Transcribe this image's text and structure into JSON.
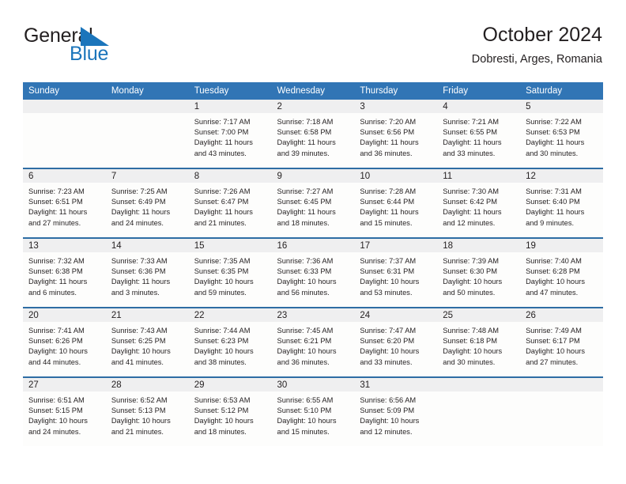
{
  "brand": {
    "name_part1": "General",
    "name_part2": "Blue",
    "flag_color": "#1b75bb",
    "text_color": "#231f20"
  },
  "header": {
    "title": "October 2024",
    "subtitle": "Dobresti, Arges, Romania"
  },
  "theme": {
    "header_blue": "#3175b5",
    "row_rule_blue": "#2e6da4",
    "daynum_band": "#efeff0",
    "cell_background": "#fdfdfc"
  },
  "weekday_headers": [
    "Sunday",
    "Monday",
    "Tuesday",
    "Wednesday",
    "Thursday",
    "Friday",
    "Saturday"
  ],
  "weeks": [
    [
      {
        "day": "",
        "sunrise": "",
        "sunset": "",
        "daylight_line1": "",
        "daylight_line2": "",
        "empty": true
      },
      {
        "day": "",
        "sunrise": "",
        "sunset": "",
        "daylight_line1": "",
        "daylight_line2": "",
        "empty": true
      },
      {
        "day": "1",
        "sunrise": "Sunrise: 7:17 AM",
        "sunset": "Sunset: 7:00 PM",
        "daylight_line1": "Daylight: 11 hours",
        "daylight_line2": "and 43 minutes."
      },
      {
        "day": "2",
        "sunrise": "Sunrise: 7:18 AM",
        "sunset": "Sunset: 6:58 PM",
        "daylight_line1": "Daylight: 11 hours",
        "daylight_line2": "and 39 minutes."
      },
      {
        "day": "3",
        "sunrise": "Sunrise: 7:20 AM",
        "sunset": "Sunset: 6:56 PM",
        "daylight_line1": "Daylight: 11 hours",
        "daylight_line2": "and 36 minutes."
      },
      {
        "day": "4",
        "sunrise": "Sunrise: 7:21 AM",
        "sunset": "Sunset: 6:55 PM",
        "daylight_line1": "Daylight: 11 hours",
        "daylight_line2": "and 33 minutes."
      },
      {
        "day": "5",
        "sunrise": "Sunrise: 7:22 AM",
        "sunset": "Sunset: 6:53 PM",
        "daylight_line1": "Daylight: 11 hours",
        "daylight_line2": "and 30 minutes."
      }
    ],
    [
      {
        "day": "6",
        "sunrise": "Sunrise: 7:23 AM",
        "sunset": "Sunset: 6:51 PM",
        "daylight_line1": "Daylight: 11 hours",
        "daylight_line2": "and 27 minutes."
      },
      {
        "day": "7",
        "sunrise": "Sunrise: 7:25 AM",
        "sunset": "Sunset: 6:49 PM",
        "daylight_line1": "Daylight: 11 hours",
        "daylight_line2": "and 24 minutes."
      },
      {
        "day": "8",
        "sunrise": "Sunrise: 7:26 AM",
        "sunset": "Sunset: 6:47 PM",
        "daylight_line1": "Daylight: 11 hours",
        "daylight_line2": "and 21 minutes."
      },
      {
        "day": "9",
        "sunrise": "Sunrise: 7:27 AM",
        "sunset": "Sunset: 6:45 PM",
        "daylight_line1": "Daylight: 11 hours",
        "daylight_line2": "and 18 minutes."
      },
      {
        "day": "10",
        "sunrise": "Sunrise: 7:28 AM",
        "sunset": "Sunset: 6:44 PM",
        "daylight_line1": "Daylight: 11 hours",
        "daylight_line2": "and 15 minutes."
      },
      {
        "day": "11",
        "sunrise": "Sunrise: 7:30 AM",
        "sunset": "Sunset: 6:42 PM",
        "daylight_line1": "Daylight: 11 hours",
        "daylight_line2": "and 12 minutes."
      },
      {
        "day": "12",
        "sunrise": "Sunrise: 7:31 AM",
        "sunset": "Sunset: 6:40 PM",
        "daylight_line1": "Daylight: 11 hours",
        "daylight_line2": "and 9 minutes."
      }
    ],
    [
      {
        "day": "13",
        "sunrise": "Sunrise: 7:32 AM",
        "sunset": "Sunset: 6:38 PM",
        "daylight_line1": "Daylight: 11 hours",
        "daylight_line2": "and 6 minutes."
      },
      {
        "day": "14",
        "sunrise": "Sunrise: 7:33 AM",
        "sunset": "Sunset: 6:36 PM",
        "daylight_line1": "Daylight: 11 hours",
        "daylight_line2": "and 3 minutes."
      },
      {
        "day": "15",
        "sunrise": "Sunrise: 7:35 AM",
        "sunset": "Sunset: 6:35 PM",
        "daylight_line1": "Daylight: 10 hours",
        "daylight_line2": "and 59 minutes."
      },
      {
        "day": "16",
        "sunrise": "Sunrise: 7:36 AM",
        "sunset": "Sunset: 6:33 PM",
        "daylight_line1": "Daylight: 10 hours",
        "daylight_line2": "and 56 minutes."
      },
      {
        "day": "17",
        "sunrise": "Sunrise: 7:37 AM",
        "sunset": "Sunset: 6:31 PM",
        "daylight_line1": "Daylight: 10 hours",
        "daylight_line2": "and 53 minutes."
      },
      {
        "day": "18",
        "sunrise": "Sunrise: 7:39 AM",
        "sunset": "Sunset: 6:30 PM",
        "daylight_line1": "Daylight: 10 hours",
        "daylight_line2": "and 50 minutes."
      },
      {
        "day": "19",
        "sunrise": "Sunrise: 7:40 AM",
        "sunset": "Sunset: 6:28 PM",
        "daylight_line1": "Daylight: 10 hours",
        "daylight_line2": "and 47 minutes."
      }
    ],
    [
      {
        "day": "20",
        "sunrise": "Sunrise: 7:41 AM",
        "sunset": "Sunset: 6:26 PM",
        "daylight_line1": "Daylight: 10 hours",
        "daylight_line2": "and 44 minutes."
      },
      {
        "day": "21",
        "sunrise": "Sunrise: 7:43 AM",
        "sunset": "Sunset: 6:25 PM",
        "daylight_line1": "Daylight: 10 hours",
        "daylight_line2": "and 41 minutes."
      },
      {
        "day": "22",
        "sunrise": "Sunrise: 7:44 AM",
        "sunset": "Sunset: 6:23 PM",
        "daylight_line1": "Daylight: 10 hours",
        "daylight_line2": "and 38 minutes."
      },
      {
        "day": "23",
        "sunrise": "Sunrise: 7:45 AM",
        "sunset": "Sunset: 6:21 PM",
        "daylight_line1": "Daylight: 10 hours",
        "daylight_line2": "and 36 minutes."
      },
      {
        "day": "24",
        "sunrise": "Sunrise: 7:47 AM",
        "sunset": "Sunset: 6:20 PM",
        "daylight_line1": "Daylight: 10 hours",
        "daylight_line2": "and 33 minutes."
      },
      {
        "day": "25",
        "sunrise": "Sunrise: 7:48 AM",
        "sunset": "Sunset: 6:18 PM",
        "daylight_line1": "Daylight: 10 hours",
        "daylight_line2": "and 30 minutes."
      },
      {
        "day": "26",
        "sunrise": "Sunrise: 7:49 AM",
        "sunset": "Sunset: 6:17 PM",
        "daylight_line1": "Daylight: 10 hours",
        "daylight_line2": "and 27 minutes."
      }
    ],
    [
      {
        "day": "27",
        "sunrise": "Sunrise: 6:51 AM",
        "sunset": "Sunset: 5:15 PM",
        "daylight_line1": "Daylight: 10 hours",
        "daylight_line2": "and 24 minutes."
      },
      {
        "day": "28",
        "sunrise": "Sunrise: 6:52 AM",
        "sunset": "Sunset: 5:13 PM",
        "daylight_line1": "Daylight: 10 hours",
        "daylight_line2": "and 21 minutes."
      },
      {
        "day": "29",
        "sunrise": "Sunrise: 6:53 AM",
        "sunset": "Sunset: 5:12 PM",
        "daylight_line1": "Daylight: 10 hours",
        "daylight_line2": "and 18 minutes."
      },
      {
        "day": "30",
        "sunrise": "Sunrise: 6:55 AM",
        "sunset": "Sunset: 5:10 PM",
        "daylight_line1": "Daylight: 10 hours",
        "daylight_line2": "and 15 minutes."
      },
      {
        "day": "31",
        "sunrise": "Sunrise: 6:56 AM",
        "sunset": "Sunset: 5:09 PM",
        "daylight_line1": "Daylight: 10 hours",
        "daylight_line2": "and 12 minutes."
      },
      {
        "day": "",
        "sunrise": "",
        "sunset": "",
        "daylight_line1": "",
        "daylight_line2": "",
        "empty": true
      },
      {
        "day": "",
        "sunrise": "",
        "sunset": "",
        "daylight_line1": "",
        "daylight_line2": "",
        "empty": true
      }
    ]
  ]
}
